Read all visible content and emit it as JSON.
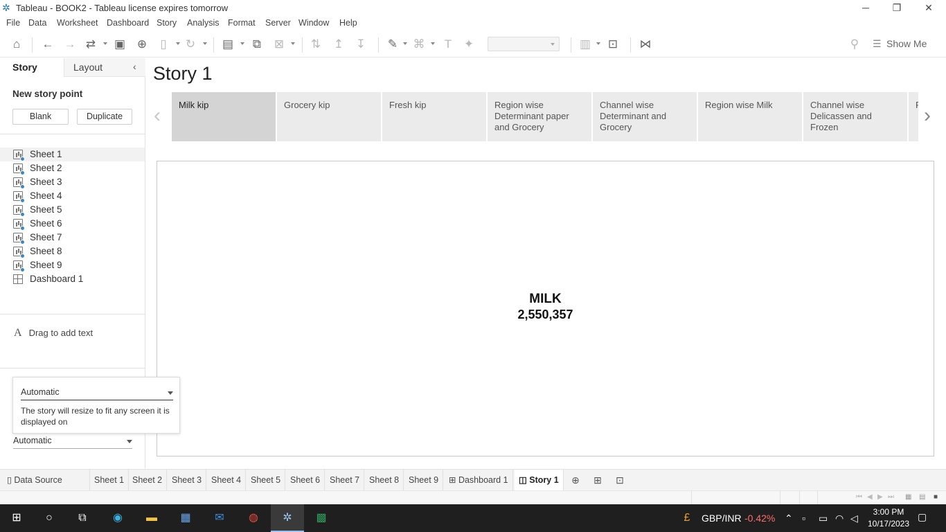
{
  "window": {
    "title": "Tableau - BOOK2 - Tableau license expires tomorrow",
    "minimize": "─",
    "restore": "❐",
    "close": "✕"
  },
  "menu": [
    "File",
    "Data",
    "Worksheet",
    "Dashboard",
    "Story",
    "Analysis",
    "Format",
    "Server",
    "Window",
    "Help"
  ],
  "toolbar": {
    "show_me_label": "Show Me"
  },
  "left_panel": {
    "tabs": {
      "story": "Story",
      "layout": "Layout"
    },
    "new_story_point": "New story point",
    "blank_button": "Blank",
    "duplicate_button": "Duplicate",
    "sheets": [
      {
        "label": "Sheet 1",
        "type": "worksheet",
        "selected": true
      },
      {
        "label": "Sheet 2",
        "type": "worksheet"
      },
      {
        "label": "Sheet 3",
        "type": "worksheet"
      },
      {
        "label": "Sheet 4",
        "type": "worksheet"
      },
      {
        "label": "Sheet 5",
        "type": "worksheet"
      },
      {
        "label": "Sheet 6",
        "type": "worksheet"
      },
      {
        "label": "Sheet 7",
        "type": "worksheet"
      },
      {
        "label": "Sheet 8",
        "type": "worksheet"
      },
      {
        "label": "Sheet 9",
        "type": "worksheet"
      },
      {
        "label": "Dashboard 1",
        "type": "dashboard"
      }
    ],
    "drag_to_add_text": "Drag to add text",
    "size_popup": {
      "selected": "Automatic",
      "description": "The story will resize to fit any screen it is displayed on"
    },
    "size_select_value": "Automatic"
  },
  "story": {
    "title": "Story 1",
    "points": [
      {
        "label": "Milk kip",
        "active": true
      },
      {
        "label": "Grocery kip"
      },
      {
        "label": "Fresh kip"
      },
      {
        "label": "Region wise Determinant paper and Grocery"
      },
      {
        "label": "Channel wise Determinant  and Grocery"
      },
      {
        "label": "Region wise Milk"
      },
      {
        "label": "Channel wise Delicassen and Frozen"
      },
      {
        "label": "R D"
      }
    ],
    "kpi": {
      "label": "MILK",
      "value": "2,550,357"
    }
  },
  "bottom_tabs": [
    {
      "label": "Data Source",
      "icon": "database-icon"
    },
    {
      "label": "Sheet 1"
    },
    {
      "label": "Sheet 2"
    },
    {
      "label": "Sheet 3"
    },
    {
      "label": "Sheet 4"
    },
    {
      "label": "Sheet 5"
    },
    {
      "label": "Sheet 6"
    },
    {
      "label": "Sheet 7"
    },
    {
      "label": "Sheet 8"
    },
    {
      "label": "Sheet 9"
    },
    {
      "label": "Dashboard 1",
      "icon": "dashboard-icon"
    },
    {
      "label": "Story 1",
      "icon": "story-icon",
      "active": true
    }
  ],
  "taskbar": {
    "ticker_label": "GBP/INR",
    "ticker_change": "-0.42%",
    "time": "3:00 PM",
    "date": "10/17/2023"
  },
  "colors": {
    "accent": "#1f77b4",
    "ticker_negative": "#ff6b6b",
    "active_point": "#d4d4d4"
  }
}
